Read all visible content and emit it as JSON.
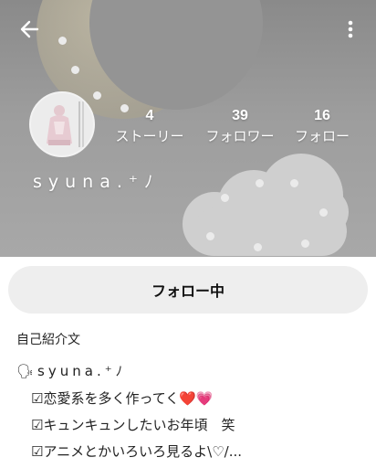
{
  "header": {
    "back_icon": "arrow-left-icon",
    "menu_icon": "more-vertical-icon"
  },
  "profile": {
    "username": "syuna.⁺ﾉ",
    "avatar_icon": "profile-avatar",
    "stats": [
      {
        "value": "4",
        "label": "ストーリー"
      },
      {
        "value": "39",
        "label": "フォロワー"
      },
      {
        "value": "16",
        "label": "フォロー"
      }
    ]
  },
  "actions": {
    "follow_label": "フォロー中"
  },
  "bio": {
    "title": "自己紹介文",
    "lines": [
      "🗣syuna.⁺ﾉ",
      "☑恋愛系を多く作ってく❤️💗",
      "☑キュンキュンしたいお年頃　笑",
      "☑アニメとかいろいろ見るよ\\♡/..."
    ]
  },
  "colors": {
    "header_bg": "#9a9a9a",
    "button_bg": "#eeeeee",
    "text": "#222222"
  }
}
